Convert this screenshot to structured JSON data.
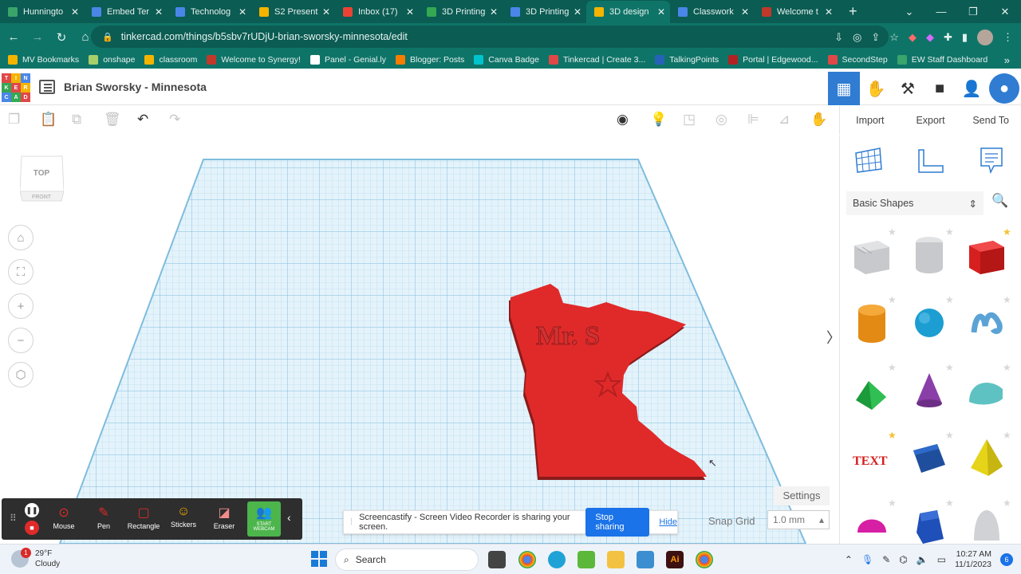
{
  "browser": {
    "tabs": [
      {
        "title": "Hunningto",
        "icon": "greenhouse-icon",
        "color": "#3aa46b"
      },
      {
        "title": "Embed Ter",
        "icon": "docs-icon",
        "color": "#4a86e8"
      },
      {
        "title": "Technolog",
        "icon": "docs-icon",
        "color": "#4a86e8"
      },
      {
        "title": "S2 Present",
        "icon": "slides-icon",
        "color": "#f4b400"
      },
      {
        "title": "Inbox (17)",
        "icon": "gmail-icon",
        "color": "#ea4335"
      },
      {
        "title": "3D Printing",
        "icon": "drive-icon",
        "color": "#34a853"
      },
      {
        "title": "3D Printing",
        "icon": "docs-icon",
        "color": "#4a86e8"
      },
      {
        "title": "3D design",
        "icon": "tinkercad-icon",
        "color": "#f4b400",
        "active": true
      },
      {
        "title": "Classwork",
        "icon": "classroom-icon",
        "color": "#4a86e8"
      },
      {
        "title": "Welcome t",
        "icon": "synergy-icon",
        "color": "#c0392b"
      }
    ],
    "url": "tinkercad.com/things/b5sbv7rUDjU-brian-sworsky-minnesota/edit",
    "bookmarks": [
      {
        "label": "MV Bookmarks",
        "color": "#f4b400"
      },
      {
        "label": "onshape",
        "color": "#a7d06a"
      },
      {
        "label": "classroom",
        "color": "#f4b400"
      },
      {
        "label": "Welcome to Synergy!",
        "color": "#c0392b"
      },
      {
        "label": "Panel - Genial.ly",
        "color": "#ffffff"
      },
      {
        "label": "Blogger: Posts",
        "color": "#f57d00"
      },
      {
        "label": "Canva Badge",
        "color": "#00c4cc"
      },
      {
        "label": "Tinkercad | Create 3...",
        "color": "#e04848"
      },
      {
        "label": "TalkingPoints",
        "color": "#2563b8"
      },
      {
        "label": "Portal | Edgewood...",
        "color": "#b22222"
      },
      {
        "label": "SecondStep",
        "color": "#e04848"
      },
      {
        "label": "EW Staff Dashboard",
        "color": "#3aa46b"
      }
    ]
  },
  "tinkercad": {
    "logo_letters": [
      "T",
      "I",
      "N",
      "K",
      "E",
      "R",
      "C",
      "A",
      "D"
    ],
    "doc_title": "Brian Sworsky - Minnesota",
    "import_label": "Import",
    "export_label": "Export",
    "sendto_label": "Send To",
    "viewcube_top": "TOP",
    "viewcube_front": "FRONT",
    "model_text": "Mr. S",
    "settings_label": "Settings",
    "snap_label": "Snap Grid",
    "snap_value": "1.0 mm",
    "shape_category": "Basic Shapes",
    "shapes": [
      {
        "name": "box-striped",
        "favorite": false
      },
      {
        "name": "cylinder-striped",
        "favorite": false
      },
      {
        "name": "box",
        "favorite": true
      },
      {
        "name": "cylinder",
        "favorite": false
      },
      {
        "name": "sphere",
        "favorite": false
      },
      {
        "name": "scribble",
        "favorite": false
      },
      {
        "name": "roof",
        "favorite": false
      },
      {
        "name": "cone",
        "favorite": false
      },
      {
        "name": "round-roof",
        "favorite": false
      },
      {
        "name": "text",
        "favorite": true
      },
      {
        "name": "cube-tilted",
        "favorite": false
      },
      {
        "name": "pyramid",
        "favorite": false
      },
      {
        "name": "half-sphere",
        "favorite": false
      },
      {
        "name": "polygon",
        "favorite": false
      },
      {
        "name": "paraboloid",
        "favorite": false
      }
    ]
  },
  "screencastify": {
    "tools": [
      "Mouse",
      "Pen",
      "Rectangle",
      "Stickers",
      "Eraser",
      "START WEBCAM"
    ],
    "share_message": "Screencastify - Screen Video Recorder is sharing your screen.",
    "stop_label": "Stop sharing",
    "hide_label": "Hide"
  },
  "taskbar": {
    "temp": "29°F",
    "condition": "Cloudy",
    "weather_badge": "1",
    "search_label": "Search",
    "time": "10:27 AM",
    "date": "11/1/2023",
    "notifications": "6"
  }
}
